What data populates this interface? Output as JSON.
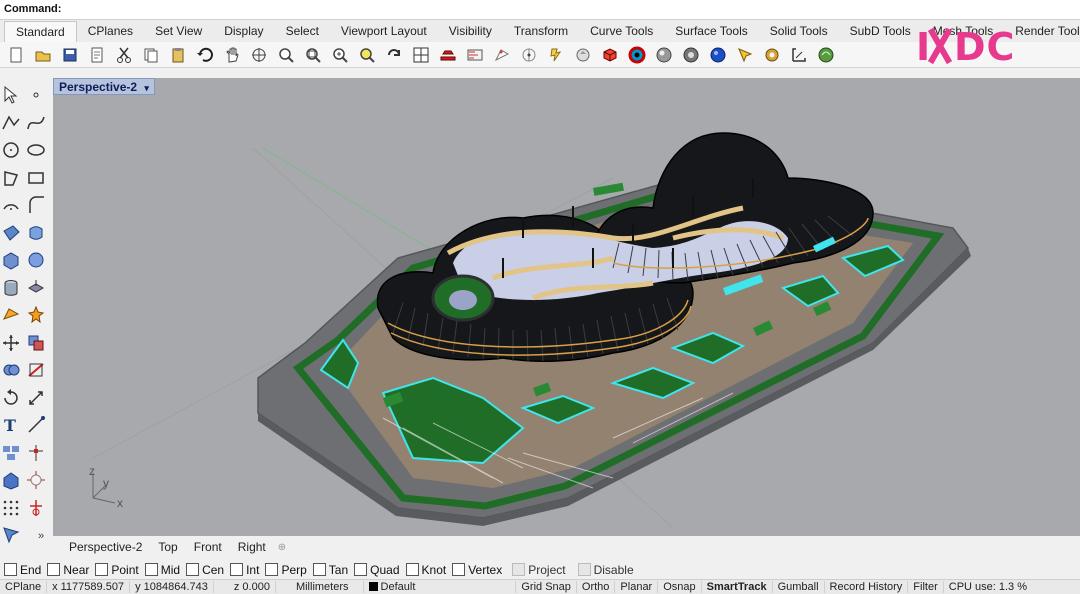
{
  "command": {
    "label": "Command:"
  },
  "tabs": [
    "Standard",
    "CPlanes",
    "Set View",
    "Display",
    "Select",
    "Viewport Layout",
    "Visibility",
    "Transform",
    "Curve Tools",
    "Surface Tools",
    "Solid Tools",
    "SubD Tools",
    "Mesh Tools",
    "Render Tools"
  ],
  "active_tab": "Standard",
  "toolbar": {
    "icons": [
      "new-file-icon",
      "open-folder-icon",
      "save-icon",
      "print-icon",
      "cut-icon",
      "copy-icon",
      "paste-icon",
      "undo-icon",
      "pan-hand-icon",
      "rotate-view-icon",
      "zoom-icon",
      "zoom-window-icon",
      "zoom-extents-icon",
      "zoom-selected-icon",
      "redraw-icon",
      "four-viewports-icon",
      "car-icon",
      "layer-icon",
      "properties-icon",
      "points-icon",
      "lightbulb-icon",
      "shaded-icon",
      "color-wheel-icon",
      "sphere-shaded-icon",
      "rendered-sphere-icon",
      "blue-sphere-icon",
      "select-filter-icon",
      "gear-settings-icon",
      "dimension-icon",
      "grasshopper-icon",
      "help-icon"
    ]
  },
  "logo": {
    "text": "IXDC"
  },
  "viewport": {
    "title": "Perspective-2",
    "axis_labels": {
      "x": "x",
      "y": "y",
      "z": "z"
    }
  },
  "view_tabs": [
    "Perspective-2",
    "Top",
    "Front",
    "Right"
  ],
  "osnap": {
    "items": [
      {
        "label": "End",
        "checked": false
      },
      {
        "label": "Near",
        "checked": false
      },
      {
        "label": "Point",
        "checked": false
      },
      {
        "label": "Mid",
        "checked": false
      },
      {
        "label": "Cen",
        "checked": false
      },
      {
        "label": "Int",
        "checked": false
      },
      {
        "label": "Perp",
        "checked": false
      },
      {
        "label": "Tan",
        "checked": false
      },
      {
        "label": "Quad",
        "checked": false
      },
      {
        "label": "Knot",
        "checked": false
      },
      {
        "label": "Vertex",
        "checked": false
      },
      {
        "label": "Project",
        "checked": false,
        "disabled": true
      },
      {
        "label": "Disable",
        "checked": false,
        "disabled": true
      }
    ]
  },
  "status": {
    "cplane": "CPlane",
    "x": "x 1177589.507",
    "y": "y 1084864.743",
    "z": "z 0.000",
    "units": "Millimeters",
    "layer": "Default",
    "grid_snap": "Grid Snap",
    "ortho": "Ortho",
    "planar": "Planar",
    "osnap": "Osnap",
    "smarttrack": "SmartTrack",
    "gumball": "Gumball",
    "record_history": "Record History",
    "filter": "Filter",
    "cpu": "CPU use: 1.3 %"
  },
  "colors": {
    "viewport_bg": "#a8a9ad",
    "slab": "#6e6f72",
    "green": "#1f6d26",
    "cyan": "#3fe4ec",
    "timber": "#e2c486",
    "interior": "#c9cfe6",
    "logo": "#e7398d"
  }
}
